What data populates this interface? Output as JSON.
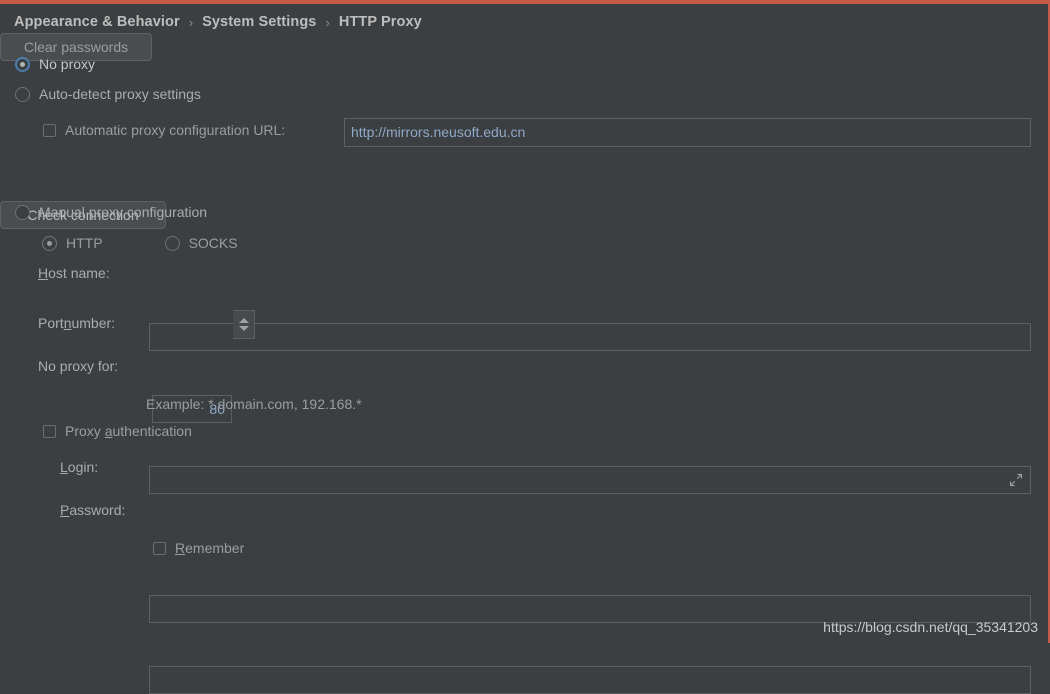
{
  "breadcrumb": {
    "items": [
      "Appearance & Behavior",
      "System Settings",
      "HTTP Proxy"
    ],
    "separator": "›"
  },
  "proxy_mode": {
    "no_proxy_label": "No proxy",
    "auto_detect_label": "Auto-detect proxy settings",
    "manual_label": "Manual proxy configuration",
    "selected": "no_proxy"
  },
  "auto": {
    "apc_url_label": "Automatic proxy configuration URL:",
    "apc_url_value": "http://mirrors.neusoft.edu.cn",
    "apc_checked": false,
    "clear_passwords_label": "Clear passwords"
  },
  "manual": {
    "protocol": {
      "http_label": "HTTP",
      "socks_label": "SOCKS",
      "selected": "HTTP"
    },
    "host_name": {
      "label_pre": "",
      "label_key": "H",
      "label_post": "ost name:",
      "value": "",
      "placeholder": ""
    },
    "port_number": {
      "label_pre": "Port ",
      "label_key": "n",
      "label_post": "umber:",
      "value": "80"
    },
    "no_proxy_for": {
      "label": "No proxy for:",
      "value": "",
      "expand_icon": "expand-icon"
    },
    "example_text": "Example: *.domain.com, 192.168.*",
    "proxy_auth": {
      "label_pre": "Proxy ",
      "label_key": "a",
      "label_post": "uthentication",
      "checked": false
    },
    "login": {
      "label_key": "L",
      "label_post": "ogin:",
      "value": ""
    },
    "password": {
      "label_key": "P",
      "label_post": "assword:",
      "value": ""
    },
    "remember": {
      "label_key": "R",
      "label_post": "emember",
      "checked": false
    }
  },
  "actions": {
    "check_connection_label": "Check connection"
  },
  "watermark": "https://blog.csdn.net/qq_35341203",
  "colors": {
    "window_bg": "#3c3f41",
    "accent_border": "#c75b4a",
    "selected_radio": "#4d7eb0",
    "field_text": "#8fa8c8",
    "label_text": "#a9acb0"
  }
}
